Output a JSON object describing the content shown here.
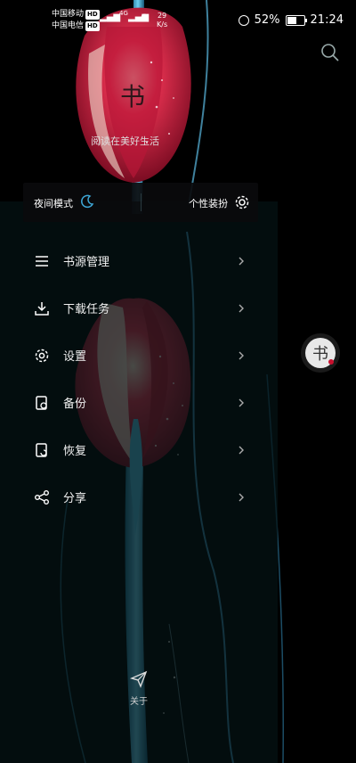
{
  "status_bar": {
    "carrier1": "中国移动",
    "carrier2": "中国电信",
    "hd": "HD",
    "net_type": "4G",
    "speed_value": "29",
    "speed_unit": "K/s",
    "battery": "52%",
    "time": "21:24"
  },
  "header": {
    "slogan": "阅读在美好生活",
    "logo_char": "书"
  },
  "toolbar": {
    "night_mode": "夜间模式",
    "skin": "个性装扮"
  },
  "menu": [
    {
      "label": "书源管理",
      "icon": "list-icon"
    },
    {
      "label": "下载任务",
      "icon": "download-icon"
    },
    {
      "label": "设置",
      "icon": "gear-icon"
    },
    {
      "label": "备份",
      "icon": "backup-icon"
    },
    {
      "label": "恢复",
      "icon": "restore-icon"
    },
    {
      "label": "分享",
      "icon": "share-icon"
    }
  ],
  "footer": {
    "about": "关于"
  },
  "colors": {
    "accent": "#3ea8d8",
    "drawer_bg": "#041214",
    "tulip_red": "#c8102e"
  }
}
